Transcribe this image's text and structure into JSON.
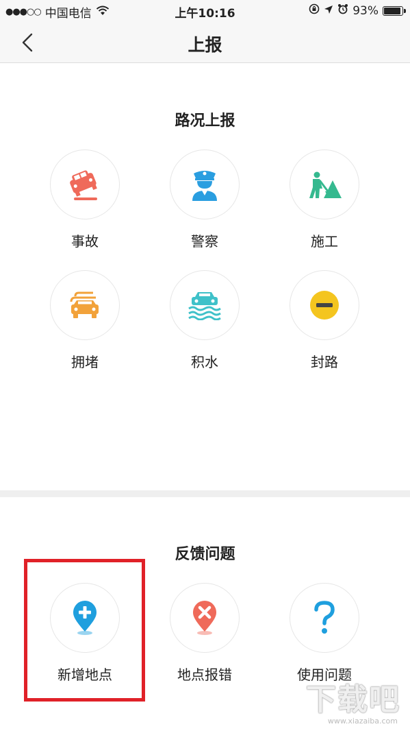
{
  "status": {
    "carrier": "中国电信",
    "time": "上午10:16",
    "battery": "93%",
    "battery_level": 0.93
  },
  "nav": {
    "title": "上报"
  },
  "road_report": {
    "title": "路况上报",
    "items": [
      {
        "label": "事故",
        "icon": "car-crash-icon",
        "color": "#ef6a5a"
      },
      {
        "label": "警察",
        "icon": "police-icon",
        "color": "#2a9ee0"
      },
      {
        "label": "施工",
        "icon": "construction-icon",
        "color": "#35b98f"
      },
      {
        "label": "拥堵",
        "icon": "congestion-icon",
        "color": "#f2a23a"
      },
      {
        "label": "积水",
        "icon": "flood-icon",
        "color": "#3fc1c9"
      },
      {
        "label": "封路",
        "icon": "road-closed-icon",
        "color": "#f4c51f"
      }
    ]
  },
  "feedback": {
    "title": "反馈问题",
    "items": [
      {
        "label": "新增地点",
        "icon": "add-location-icon",
        "color": "#1f9fde"
      },
      {
        "label": "地点报错",
        "icon": "location-error-icon",
        "color": "#ef6a5a"
      },
      {
        "label": "使用问题",
        "icon": "question-icon",
        "color": "#1f9fde"
      }
    ]
  },
  "watermark": {
    "text": "下载吧",
    "sub": "www.xiazaiba.com"
  }
}
